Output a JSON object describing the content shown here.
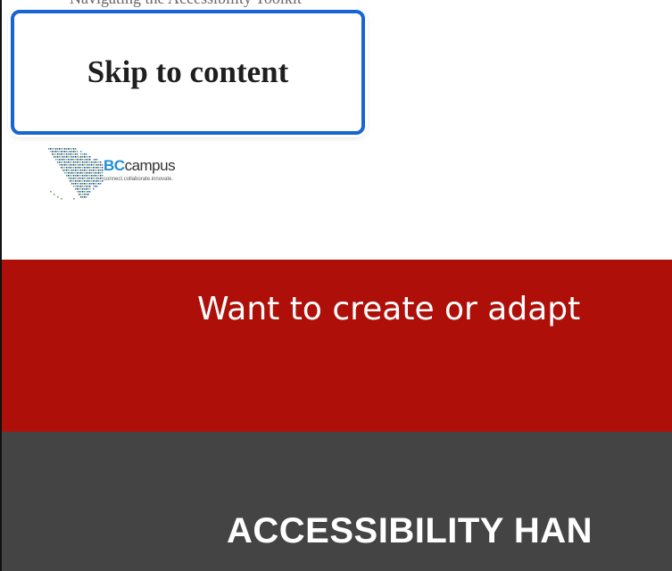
{
  "page": {
    "top_cut_text": "Navigating the Accessibility Toolkit"
  },
  "skip_link": {
    "label": "Skip to content"
  },
  "logo": {
    "brand_prefix": "BC",
    "brand_suffix": "campus",
    "tagline": "connect.collaborate.innovate.",
    "brand_color": "#1f8ed6"
  },
  "banner": {
    "text": "Want to create or adapt",
    "background": "#ae1009"
  },
  "header": {
    "book_title": "ACCESSIBILITY HAN",
    "background": "#444444"
  }
}
